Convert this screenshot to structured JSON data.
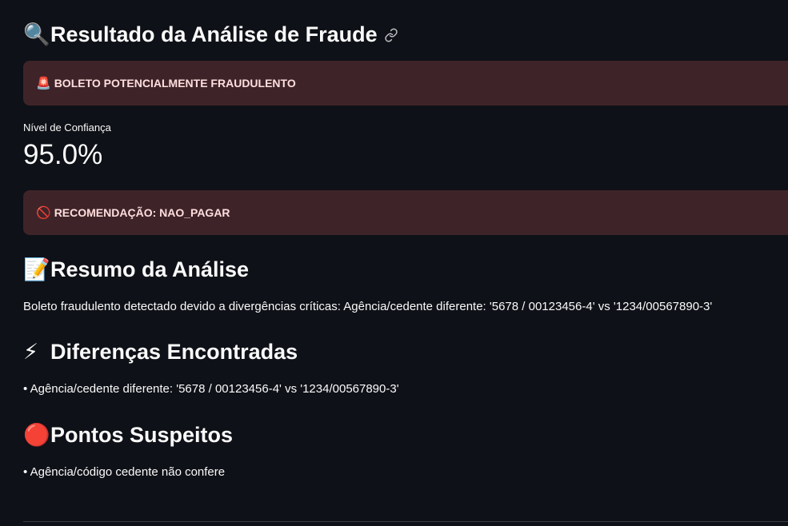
{
  "header": {
    "emoji": "🔍",
    "title": "Resultado da Análise de Fraude"
  },
  "alert_fraud": {
    "emoji": "🚨",
    "text": "BOLETO POTENCIALMENTE FRAUDULENTO"
  },
  "metric": {
    "label": "Nível de Confiança",
    "value": "95.0%"
  },
  "alert_recommendation": {
    "emoji": "🚫",
    "text": "RECOMENDAÇÃO: NAO_PAGAR"
  },
  "summary": {
    "emoji": "📝",
    "title": "Resumo da Análise",
    "text": "Boleto fraudulento detectado devido a divergências críticas: Agência/cedente diferente: '5678 / 00123456-4' vs '1234/00567890-3'"
  },
  "differences": {
    "emoji": "⚡",
    "title": "Diferenças Encontradas",
    "items": [
      "• Agência/cedente diferente: '5678 / 00123456-4' vs '1234/00567890-3'"
    ]
  },
  "suspicious": {
    "emoji": "🔴",
    "title": "Pontos Suspeitos",
    "items": [
      "• Agência/código cedente não confere"
    ]
  },
  "colors": {
    "background": "#0e1117",
    "alert_background": "#3e2428",
    "alert_text": "#ffdede"
  },
  "icons": {
    "header_link": "link-icon"
  }
}
